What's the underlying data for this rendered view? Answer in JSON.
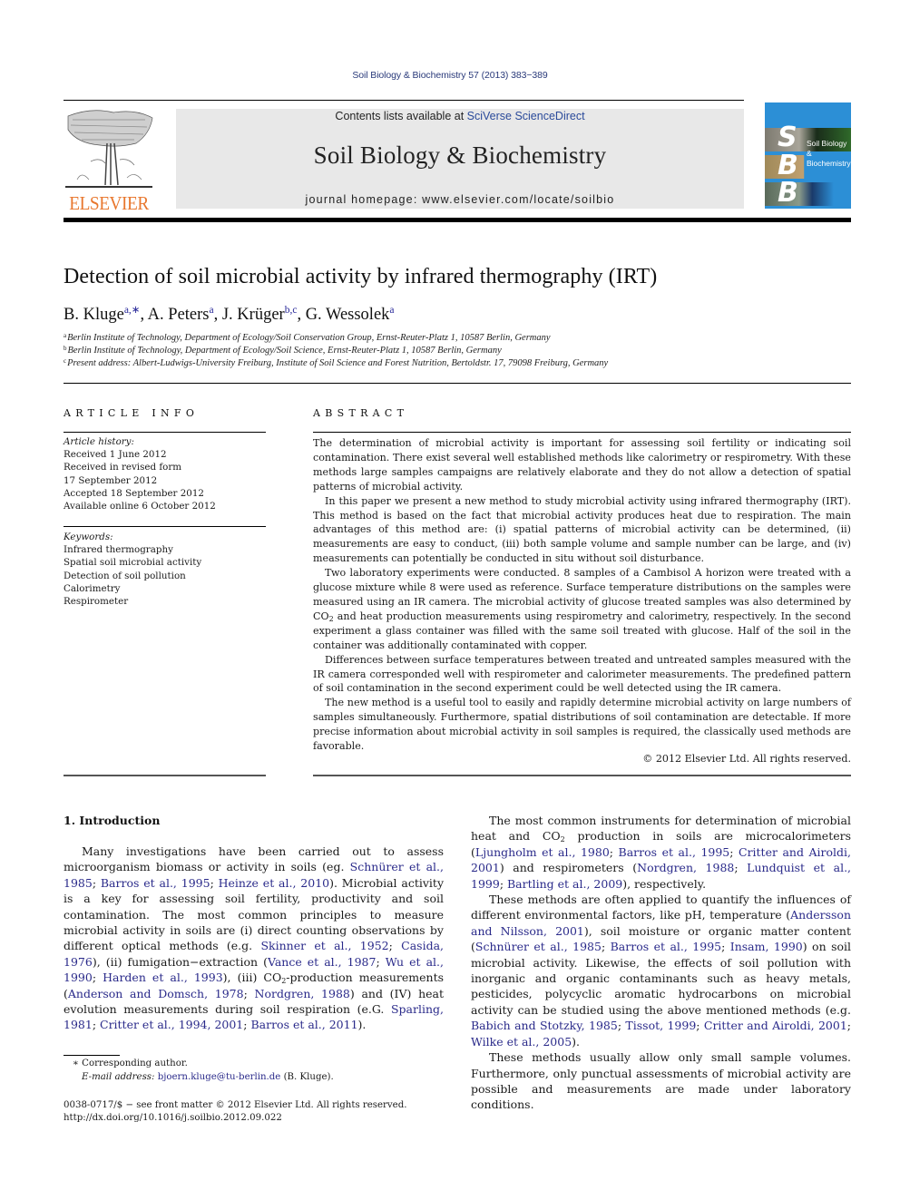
{
  "running_head": "Soil Biology & Biochemistry 57 (2013) 383−389",
  "masthead": {
    "publisher_logo_text": "ELSEVIER",
    "contents_prefix": "Contents lists available at ",
    "contents_link": "SciVerse ScienceDirect",
    "journal_title": "Soil Biology & Biochemistry",
    "homepage": "journal homepage: www.elsevier.com/locate/soilbio",
    "cover": {
      "letters": [
        "S",
        "B",
        "B"
      ],
      "title_line1": "Soil Biology &",
      "title_line2": "Biochemistry",
      "background_color": "#2c8fd6"
    },
    "logo_color": "#e8772e"
  },
  "article": {
    "title": "Detection of soil microbial activity by infrared thermography (IRT)",
    "authors": [
      {
        "name": "B. Kluge",
        "sup": "a,∗",
        "sep": ", "
      },
      {
        "name": "A. Peters",
        "sup": "a",
        "sep": ", "
      },
      {
        "name": "J. Krüger",
        "sup": "b,c",
        "sep": ", "
      },
      {
        "name": "G. Wessolek",
        "sup": "a",
        "sep": ""
      }
    ],
    "affiliations": [
      {
        "mark": "a",
        "text": "Berlin Institute of Technology, Department of Ecology/Soil Conservation Group, Ernst-Reuter-Platz 1, 10587 Berlin, Germany"
      },
      {
        "mark": "b",
        "text": "Berlin Institute of Technology, Department of Ecology/Soil Science, Ernst-Reuter-Platz 1, 10587 Berlin, Germany"
      },
      {
        "mark": "c",
        "text": "Present address: Albert-Ludwigs-University Freiburg, Institute of Soil Science and Forest Nutrition, Bertoldstr. 17, 79098 Freiburg, Germany"
      }
    ]
  },
  "article_info": {
    "heading": "ARTICLE INFO",
    "history_label": "Article history:",
    "history": [
      "Received 1 June 2012",
      "Received in revised form",
      "17 September 2012",
      "Accepted 18 September 2012",
      "Available online 6 October 2012"
    ],
    "keywords_label": "Keywords:",
    "keywords": [
      "Infrared thermography",
      "Spatial soil microbial activity",
      "Detection of soil pollution",
      "Calorimetry",
      "Respirometer"
    ]
  },
  "abstract": {
    "heading": "ABSTRACT",
    "p1": "The determination of microbial activity is important for assessing soil fertility or indicating soil contamination. There exist several well established methods like calorimetry or respirometry. With these methods large samples campaigns are relatively elaborate and they do not allow a detection of spatial patterns of microbial activity.",
    "p2": "In this paper we present a new method to study microbial activity using infrared thermography (IRT). This method is based on the fact that microbial activity produces heat due to respiration. The main advantages of this method are: (i) spatial patterns of microbial activity can be determined, (ii) measurements are easy to conduct, (iii) both sample volume and sample number can be large, and (iv) measurements can potentially be conducted in situ without soil disturbance.",
    "p3a": "Two laboratory experiments were conducted. 8 samples of a Cambisol A horizon were treated with a glucose mixture while 8 were used as reference. Surface temperature distributions on the samples were measured using an IR camera. The microbial activity of glucose treated samples was also determined by CO",
    "p3_sub": "2",
    "p3b": " and heat production measurements using respirometry and calorimetry, respectively. In the second experiment a glass container was filled with the same soil treated with glucose. Half of the soil in the container was additionally contaminated with copper.",
    "p4": "Differences between surface temperatures between treated and untreated samples measured with the IR camera corresponded well with respirometer and calorimeter measurements. The predefined pattern of soil contamination in the second experiment could be well detected using the IR camera.",
    "p5": "The new method is a useful tool to easily and rapidly determine microbial activity on large numbers of samples simultaneously. Furthermore, spatial distributions of soil contamination are detectable. If more precise information about microbial activity in soil samples is required, the classically used methods are favorable.",
    "copyright": "© 2012 Elsevier Ltd. All rights reserved."
  },
  "introduction": {
    "heading": "1.  Introduction",
    "col1": [
      {
        "t": "Many investigations have been carried out to assess microorganism biomass or activity in soils (eg. "
      },
      {
        "l": "Schnürer et al., 1985"
      },
      {
        "t": "; "
      },
      {
        "l": "Barros et al., 1995"
      },
      {
        "t": "; "
      },
      {
        "l": "Heinze et al., 2010"
      },
      {
        "t": "). Microbial activity is a key for assessing soil fertility, productivity and soil contamination. The most common principles to measure microbial activity in soils are (i) direct counting observations by different optical methods (e.g. "
      },
      {
        "l": "Skinner et al., 1952"
      },
      {
        "t": "; "
      },
      {
        "l": "Casida, 1976"
      },
      {
        "t": "), (ii) fumigation−extraction ("
      },
      {
        "l": "Vance et al., 1987"
      },
      {
        "t": "; "
      },
      {
        "l": "Wu et al., 1990"
      },
      {
        "t": "; "
      },
      {
        "l": "Harden et al., 1993"
      },
      {
        "t": "), (iii) CO"
      },
      {
        "s": "2"
      },
      {
        "t": "-production measurements ("
      },
      {
        "l": "Anderson and Domsch, 1978"
      },
      {
        "t": "; "
      },
      {
        "l": "Nordgren, 1988"
      },
      {
        "t": ") and (IV) heat evolution measurements during soil respiration (e.G. "
      },
      {
        "l": "Sparling, 1981"
      },
      {
        "t": "; "
      },
      {
        "l": "Critter et al., 1994, 2001"
      },
      {
        "t": "; "
      },
      {
        "l": "Barros et al., 2011"
      },
      {
        "t": ")."
      }
    ],
    "col2_p1": [
      {
        "t": "The most common instruments for determination of microbial heat and CO"
      },
      {
        "s": "2"
      },
      {
        "t": " production in soils are microcalorimeters ("
      },
      {
        "l": "Ljungholm et al., 1980"
      },
      {
        "t": "; "
      },
      {
        "l": "Barros et al., 1995"
      },
      {
        "t": "; "
      },
      {
        "l": "Critter and Airoldi, 2001"
      },
      {
        "t": ") and respirometers ("
      },
      {
        "l": "Nordgren, 1988"
      },
      {
        "t": "; "
      },
      {
        "l": "Lundquist et al., 1999"
      },
      {
        "t": "; "
      },
      {
        "l": "Bartling et al., 2009"
      },
      {
        "t": "), respectively."
      }
    ],
    "col2_p2": [
      {
        "t": "These methods are often applied to quantify the influences of different environmental factors, like pH, temperature ("
      },
      {
        "l": "Andersson and Nilsson, 2001"
      },
      {
        "t": "), soil moisture or organic matter content ("
      },
      {
        "l": "Schnürer et al., 1985"
      },
      {
        "t": "; "
      },
      {
        "l": "Barros et al., 1995"
      },
      {
        "t": "; "
      },
      {
        "l": "Insam, 1990"
      },
      {
        "t": ") on soil microbial activity. Likewise, the effects of soil pollution with inorganic and organic contaminants such as heavy metals, pesticides, polycyclic aromatic hydrocarbons on microbial activity can be studied using the above mentioned methods (e.g. "
      },
      {
        "l": "Babich and Stotzky, 1985"
      },
      {
        "t": "; "
      },
      {
        "l": "Tissot, 1999"
      },
      {
        "t": "; "
      },
      {
        "l": "Critter and Airoldi, 2001"
      },
      {
        "t": "; "
      },
      {
        "l": "Wilke et al., 2005"
      },
      {
        "t": ")."
      }
    ],
    "col2_p3": "These methods usually allow only small sample volumes. Furthermore, only punctual assessments of microbial activity are possible and measurements are made under laboratory conditions."
  },
  "footnotes": {
    "corresponding": "∗  Corresponding author.",
    "email_label": "E-mail address: ",
    "email": "bjoern.kluge@tu-berlin.de",
    "email_suffix": " (B. Kluge).",
    "issn_line": "0038-0717/$ − see front matter © 2012 Elsevier Ltd. All rights reserved.",
    "doi": "http://dx.doi.org/10.1016/j.soilbio.2012.09.022"
  },
  "link_color": "#2a2a8a"
}
